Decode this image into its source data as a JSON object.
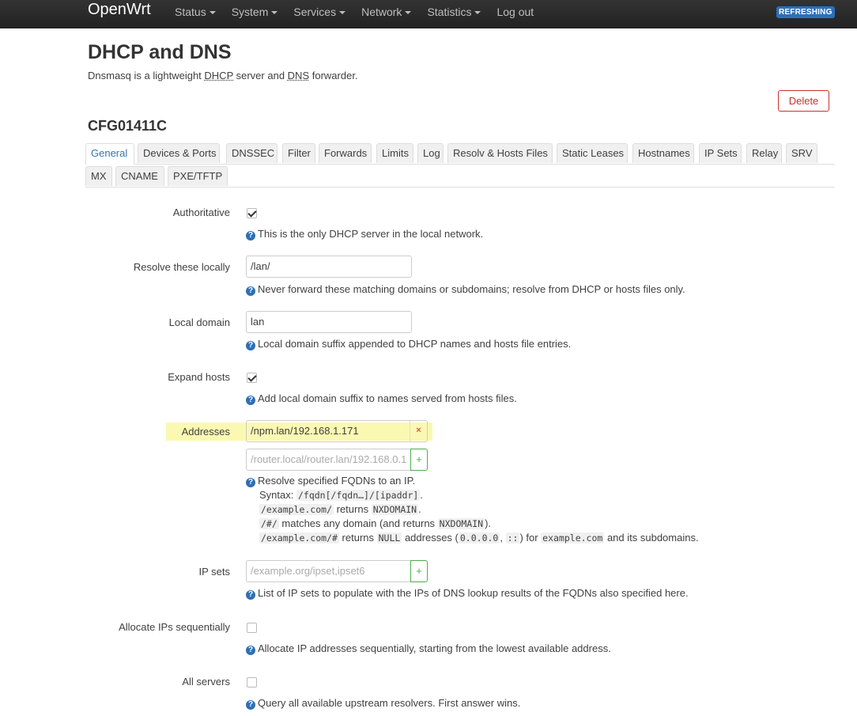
{
  "nav": {
    "brand": "OpenWrt",
    "menus": [
      "Status",
      "System",
      "Services",
      "Network",
      "Statistics"
    ],
    "logout": "Log out",
    "badge": "REFRESHING"
  },
  "page": {
    "title": "DHCP and DNS",
    "desc_prefix": "Dnsmasq is a lightweight ",
    "desc_abbr1": "DHCP",
    "desc_mid": " server and ",
    "desc_abbr2": "DNS",
    "desc_suffix": " forwarder.",
    "delete_label": "Delete",
    "section_title": "CFG01411C"
  },
  "tabs": {
    "row1": [
      "General",
      "Devices & Ports",
      "DNSSEC",
      "Filter",
      "Forwards",
      "Limits",
      "Log",
      "Resolv & Hosts Files",
      "Static Leases",
      "Hostnames",
      "IP Sets",
      "Relay",
      "SRV"
    ],
    "row2": [
      "MX",
      "CNAME",
      "PXE/TFTP"
    ],
    "active": "General"
  },
  "fields": {
    "authoritative": {
      "label": "Authoritative",
      "checked": true,
      "help": "This is the only DHCP server in the local network."
    },
    "resolve_locally": {
      "label": "Resolve these locally",
      "value": "/lan/",
      "help": "Never forward these matching domains or subdomains; resolve from DHCP or hosts files only."
    },
    "local_domain": {
      "label": "Local domain",
      "value": "lan",
      "help": "Local domain suffix appended to DHCP names and hosts file entries."
    },
    "expand_hosts": {
      "label": "Expand hosts",
      "checked": true,
      "help": "Add local domain suffix to names served from hosts files."
    },
    "addresses": {
      "label": "Addresses",
      "value": "/npm.lan/192.168.1.171",
      "remove_label": "×",
      "placeholder": "/router.local/router.lan/192.168.0.1",
      "add_label": "+",
      "help": "Resolve specified FQDNs to an IP.",
      "syntax_label": "Syntax: ",
      "syntax_code": "/fqdn[/fqdn…]/[ipaddr]",
      "ex1_code": "/example.com/",
      "ex1_text": " returns ",
      "ex1_code2": "NXDOMAIN",
      "ex2_code": "/#/",
      "ex2_text": " matches any domain (and returns ",
      "ex2_code2": "NXDOMAIN",
      "ex2_end": ").",
      "ex3_code": "/example.com/#",
      "ex3_text1": " returns ",
      "ex3_code2": "NULL",
      "ex3_text2": " addresses (",
      "ex3_code3": "0.0.0.0",
      "ex3_code4": "::",
      "ex3_text3": ") for ",
      "ex3_code5": "example.com",
      "ex3_text4": " and its subdomains."
    },
    "ip_sets": {
      "label": "IP sets",
      "placeholder": "/example.org/ipset,ipset6",
      "add_label": "+",
      "help": "List of IP sets to populate with the IPs of DNS lookup results of the FQDNs also specified here."
    },
    "sequential": {
      "label": "Allocate IPs sequentially",
      "checked": false,
      "help": "Allocate IP addresses sequentially, starting from the lowest available address."
    },
    "all_servers": {
      "label": "All servers",
      "checked": false,
      "help": "Query all available upstream resolvers. First answer wins."
    }
  }
}
